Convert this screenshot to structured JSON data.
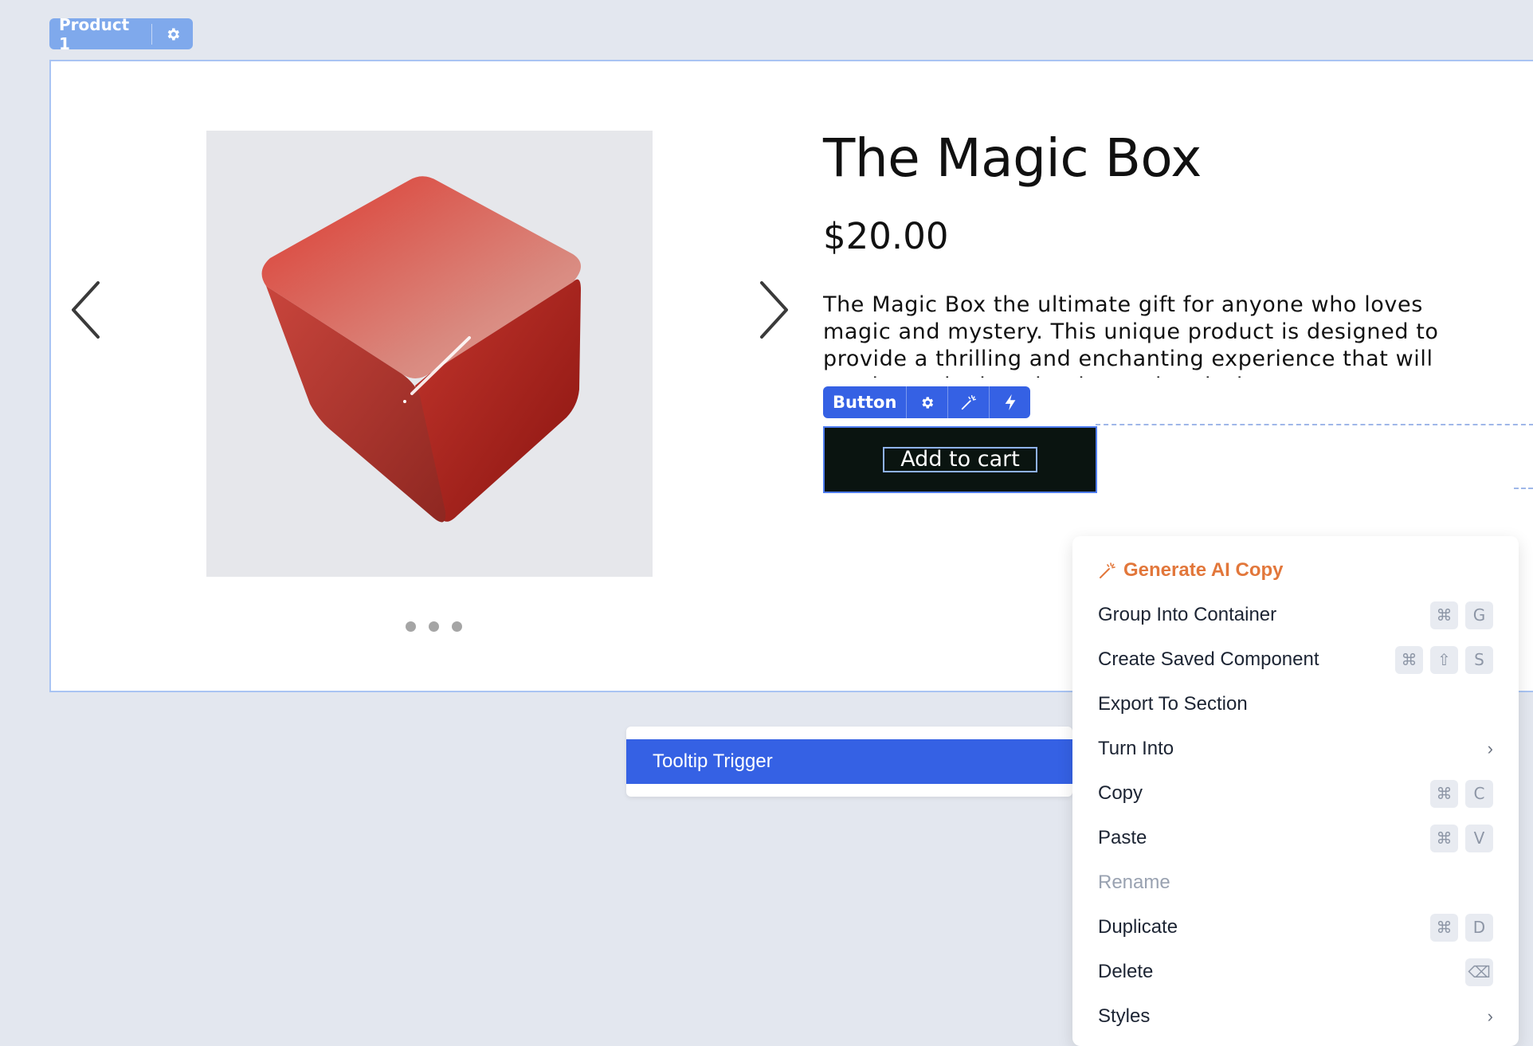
{
  "section_tag": {
    "label": "Product 1",
    "icon": "gear-icon"
  },
  "product": {
    "title": "The Magic Box",
    "price": "$20.00",
    "description": "The Magic Box the ultimate gift for anyone who loves magic and mystery. This unique product is designed to provide a thrilling and enchanting experience that will captivate the imagination and curiosity.",
    "carousel_dots": 3
  },
  "button_toolbar": {
    "label": "Button",
    "icons": [
      "gear-icon",
      "magic-wand-icon",
      "lightning-icon"
    ]
  },
  "add_to_cart": {
    "label": "Add to cart"
  },
  "tooltip": {
    "label": "Tooltip Trigger"
  },
  "context_menu": {
    "items": [
      {
        "label": "Generate AI Copy",
        "style": "ai",
        "icon": "magic-wand-icon"
      },
      {
        "label": "Group Into Container",
        "keys": [
          "⌘",
          "G"
        ]
      },
      {
        "label": "Create Saved Component",
        "keys": [
          "⌘",
          "⇧",
          "S"
        ]
      },
      {
        "label": "Export To Section"
      },
      {
        "label": "Turn Into",
        "submenu": true
      },
      {
        "label": "Copy",
        "keys": [
          "⌘",
          "C"
        ]
      },
      {
        "label": "Paste",
        "keys": [
          "⌘",
          "V"
        ]
      },
      {
        "label": "Rename",
        "style": "disabled"
      },
      {
        "label": "Duplicate",
        "keys": [
          "⌘",
          "D"
        ]
      },
      {
        "label": "Delete",
        "keys": [
          "⌫"
        ]
      },
      {
        "label": "Styles",
        "submenu": true
      }
    ]
  },
  "colors": {
    "canvas": "#e3e7ef",
    "accent": "#3561e4",
    "ai_orange": "#e2773b",
    "cube_red": "#d8403a"
  }
}
